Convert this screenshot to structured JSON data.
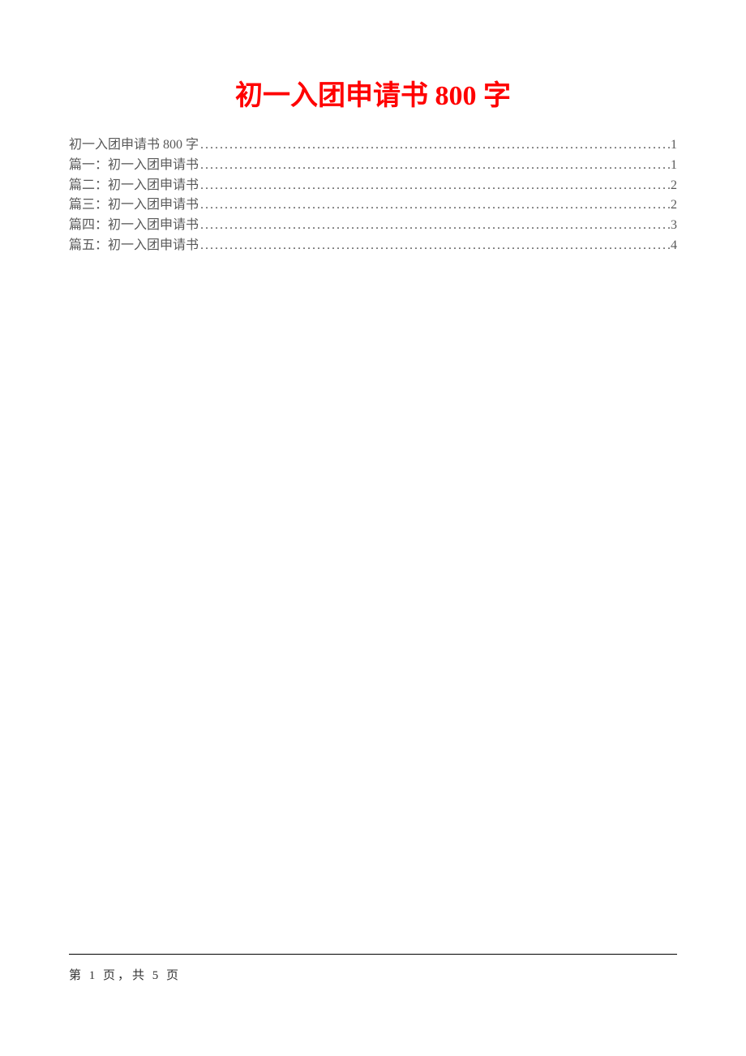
{
  "title": "初一入团申请书 800 字",
  "toc": [
    {
      "label": "初一入团申请书 800 字",
      "page": "1"
    },
    {
      "label": "篇一：初一入团申请书",
      "page": "1"
    },
    {
      "label": "篇二：初一入团申请书",
      "page": "2"
    },
    {
      "label": "篇三：初一入团申请书",
      "page": "2"
    },
    {
      "label": "篇四：初一入团申请书",
      "page": "3"
    },
    {
      "label": "篇五：初一入团申请书",
      "page": "4"
    }
  ],
  "footer": {
    "page_text": "第 1 页，共 5 页"
  }
}
